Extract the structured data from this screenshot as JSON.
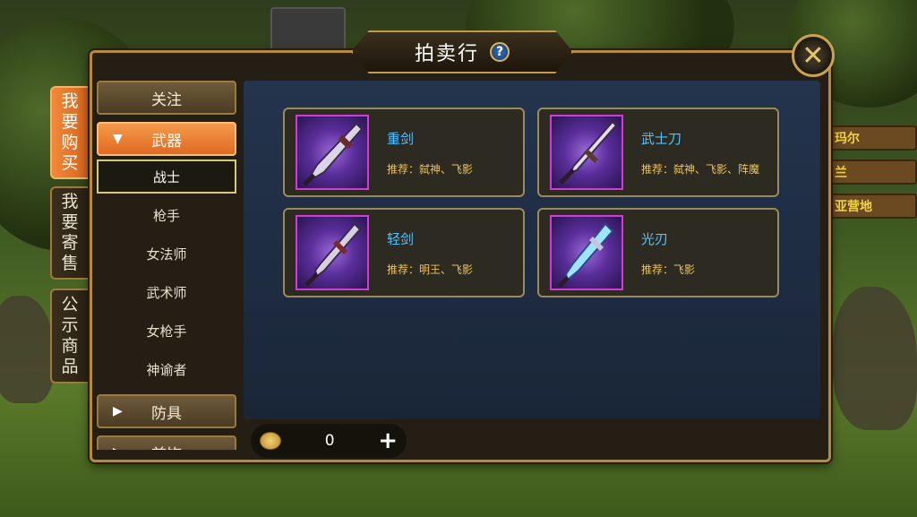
{
  "window": {
    "title": "拍卖行",
    "help_icon": "?",
    "close_icon": "✕"
  },
  "side_tabs": [
    {
      "label": [
        "我",
        "要",
        "购",
        "买"
      ],
      "active": true
    },
    {
      "label": [
        "我",
        "要",
        "寄",
        "售"
      ],
      "active": false
    },
    {
      "label": [
        "公",
        "示",
        "商",
        "品"
      ],
      "active": false
    }
  ],
  "categories": {
    "follow": "关注",
    "weapon": "武器",
    "armor": "防具",
    "accessory": "首饰"
  },
  "subcategories": [
    "战士",
    "枪手",
    "女法师",
    "武术师",
    "女枪手",
    "神谕者"
  ],
  "selected_subcategory": "战士",
  "items": [
    {
      "name": "重剑",
      "recommend": "推荐：弑神、飞影"
    },
    {
      "name": "武士刀",
      "recommend": "推荐：弑神、飞影、阵魔"
    },
    {
      "name": "轻剑",
      "recommend": "推荐：明王、飞影"
    },
    {
      "name": "光刃",
      "recommend": "推荐：飞影"
    }
  ],
  "currency": {
    "amount": "0",
    "add_icon": "+"
  },
  "background_signs": [
    "玛尔",
    "兰",
    "亚营地"
  ],
  "colors": {
    "accent_orange": "#e06a23",
    "item_name_blue": "#4fc2ff",
    "recommend_gold": "#e9c35a",
    "frame_gold": "#b48a3c",
    "rarity_purple": "#d23cd6"
  }
}
